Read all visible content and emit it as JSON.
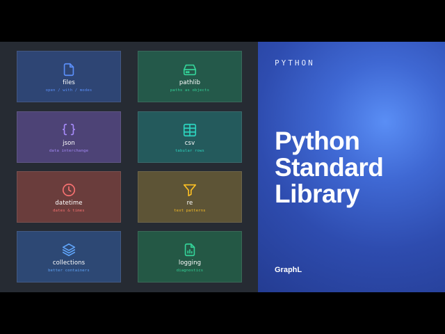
{
  "cards": [
    {
      "title": "files",
      "subtitle": "open / with / modes",
      "icon": "file-icon",
      "color": "#5b8ff9",
      "bg": "#2e4574"
    },
    {
      "title": "pathlib",
      "subtitle": "paths as objects",
      "icon": "drive-icon",
      "color": "#34d399",
      "bg": "#24594a"
    },
    {
      "title": "json",
      "subtitle": "data interchange",
      "icon": "braces-icon",
      "color": "#a78bfa",
      "bg": "#4d4376"
    },
    {
      "title": "csv",
      "subtitle": "tabular rows",
      "icon": "table-icon",
      "color": "#2dd4bf",
      "bg": "#245a5c"
    },
    {
      "title": "datetime",
      "subtitle": "dates & times",
      "icon": "clock-icon",
      "color": "#f87171",
      "bg": "#6a3d3c"
    },
    {
      "title": "re",
      "subtitle": "text patterns",
      "icon": "filter-icon",
      "color": "#fbbf24",
      "bg": "#5d5436"
    },
    {
      "title": "collections",
      "subtitle": "better containers",
      "icon": "layers-icon",
      "color": "#60a5fa",
      "bg": "#2d4874"
    },
    {
      "title": "logging",
      "subtitle": "diagnostics",
      "icon": "report-icon",
      "color": "#34d399",
      "bg": "#245845"
    }
  ],
  "hero": {
    "eyebrow": "PYTHON",
    "headline": [
      "Python",
      "Standard",
      "Library"
    ],
    "brand": "GraphL"
  }
}
